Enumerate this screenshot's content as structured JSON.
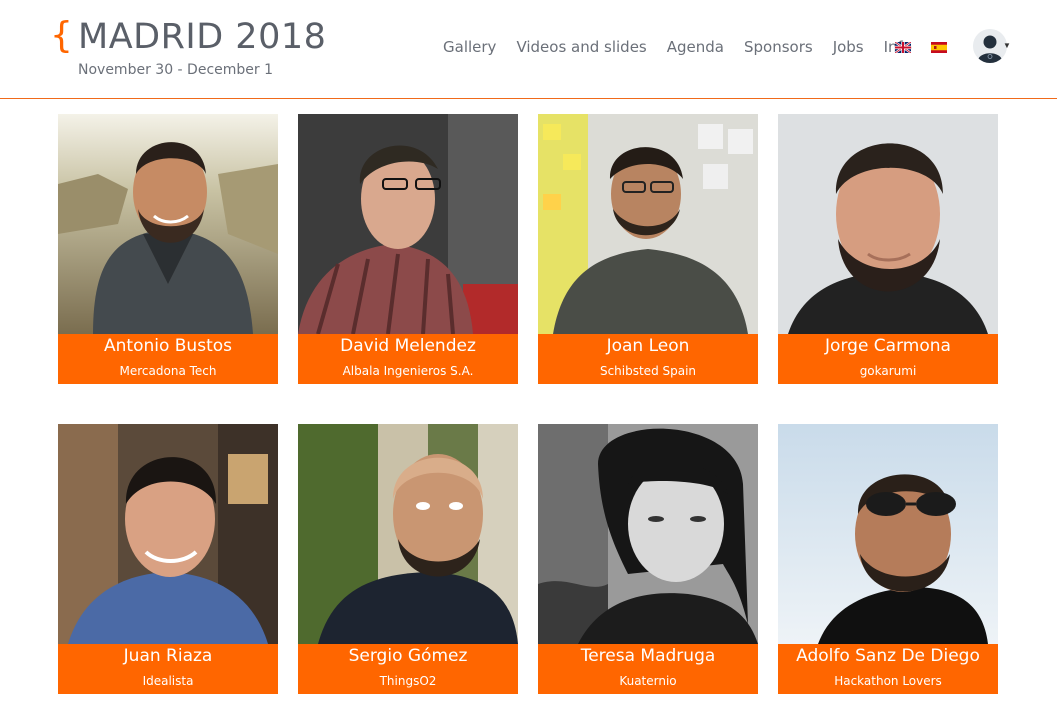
{
  "header": {
    "brace": "{",
    "title": "MADRID 2018",
    "dates": "November 30 - December 1"
  },
  "nav": {
    "items": [
      "Gallery",
      "Videos and slides",
      "Agenda",
      "Sponsors",
      "Jobs",
      "Info"
    ],
    "flags": [
      "uk-flag-icon",
      "es-flag-icon"
    ],
    "user_menu": "user-avatar-icon"
  },
  "colors": {
    "accent": "#ff6600",
    "text": "#5a5f68"
  },
  "speakers": [
    {
      "name": "Antonio Bustos",
      "company": "Mercadona Tech"
    },
    {
      "name": "David Melendez",
      "company": "Albala Ingenieros S.A."
    },
    {
      "name": "Joan Leon",
      "company": "Schibsted Spain"
    },
    {
      "name": "Jorge Carmona",
      "company": "gokarumi"
    },
    {
      "name": "Juan Riaza",
      "company": "Idealista"
    },
    {
      "name": "Sergio Gómez",
      "company": "ThingsO2"
    },
    {
      "name": "Teresa Madruga",
      "company": "Kuaternio"
    },
    {
      "name": "Adolfo Sanz De Diego",
      "company": "Hackathon Lovers"
    }
  ]
}
